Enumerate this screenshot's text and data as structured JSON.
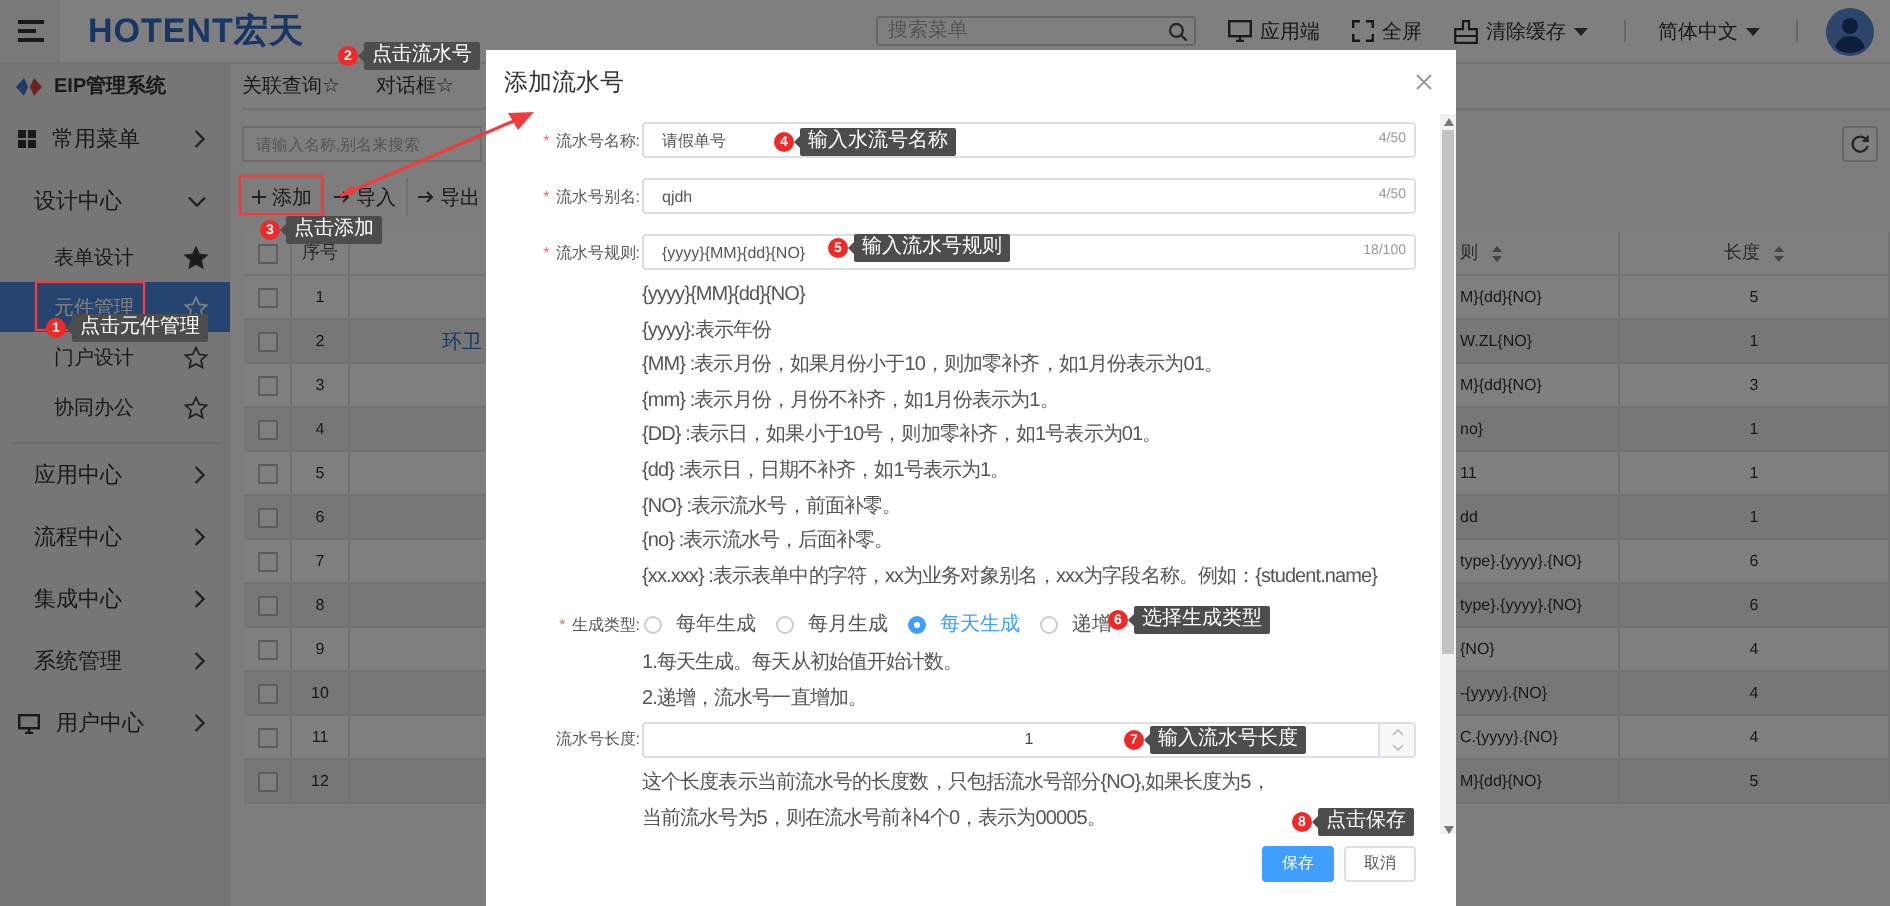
{
  "header": {
    "logo": "HOTENT宏天",
    "search": {
      "placeholder": "搜索菜单"
    },
    "actions": [
      {
        "kind": "app",
        "label": "应用端",
        "dropdown": false
      },
      {
        "kind": "fullscreen",
        "label": "全屏",
        "dropdown": false
      },
      {
        "kind": "cache",
        "label": "清除缓存",
        "dropdown": true
      },
      {
        "kind": "language",
        "label": "简体中文",
        "dropdown": true
      }
    ]
  },
  "sidebar": {
    "title": "EIP管理系统",
    "items": [
      {
        "kind": "grid",
        "label": "常用菜单",
        "expanded": false
      },
      {
        "kind": "plain",
        "label": "设计中心",
        "expanded": true,
        "children": [
          {
            "label": "表单设计",
            "favorite": true,
            "selected": false
          },
          {
            "label": "元件管理",
            "favorite": false,
            "selected": true
          },
          {
            "label": "门户设计",
            "favorite": false,
            "selected": false
          },
          {
            "label": "协同办公",
            "favorite": false,
            "selected": false
          }
        ]
      },
      {
        "kind": "plain",
        "label": "应用中心",
        "expanded": false
      },
      {
        "kind": "plain",
        "label": "流程中心",
        "expanded": false
      },
      {
        "kind": "plain",
        "label": "集成中心",
        "expanded": false
      },
      {
        "kind": "plain",
        "label": "系统管理",
        "expanded": false
      },
      {
        "kind": "monitor",
        "label": "用户中心",
        "expanded": false
      }
    ]
  },
  "tabs": [
    {
      "label": "关联查询☆",
      "selected": false
    },
    {
      "label": "对话框☆",
      "selected": false
    }
  ],
  "search": {
    "placeholder": "请输入名称,别名来搜索"
  },
  "toolbar": [
    {
      "kind": "add",
      "label": "添加"
    },
    {
      "kind": "import",
      "label": "导入"
    },
    {
      "kind": "export",
      "label": "导出"
    }
  ],
  "table": {
    "header_checked": false,
    "columns": [
      {
        "label": "序号",
        "sortable": false
      },
      {
        "label": "则",
        "sortable": true
      },
      {
        "label": "长度",
        "sortable": true
      }
    ],
    "rows": [
      {
        "checked": false,
        "no": "1",
        "rule": "M}{dd}{NO}",
        "length": "5"
      },
      {
        "checked": false,
        "no": "2",
        "name": "环卫",
        "rule": "W.ZL{NO}",
        "length": "1"
      },
      {
        "checked": false,
        "no": "3",
        "rule": "M}{dd}{NO}",
        "length": "3"
      },
      {
        "checked": false,
        "no": "4",
        "rule": "no}",
        "length": "1"
      },
      {
        "checked": false,
        "no": "5",
        "rule": "11",
        "length": "1"
      },
      {
        "checked": false,
        "no": "6",
        "rule": "dd",
        "length": "1"
      },
      {
        "checked": false,
        "no": "7",
        "rule": "type}.{yyyy}.{NO}",
        "length": "6"
      },
      {
        "checked": false,
        "no": "8",
        "rule": "type}.{yyyy}.{NO}",
        "length": "6"
      },
      {
        "checked": false,
        "no": "9",
        "rule": "{NO}",
        "length": "4"
      },
      {
        "checked": false,
        "no": "10",
        "rule": "-{yyyy}.{NO}",
        "length": "4"
      },
      {
        "checked": false,
        "no": "11",
        "rule": "C.{yyyy}.{NO}",
        "length": "4"
      },
      {
        "checked": false,
        "no": "12",
        "rule": "M}{dd}{NO}",
        "length": "5"
      }
    ]
  },
  "dialog": {
    "title": "添加流水号",
    "fields": [
      {
        "label": "流水号名称:",
        "required_mark": "*",
        "value": "请假单号",
        "counter": "4/50"
      },
      {
        "label": "流水号别名:",
        "required_mark": "*",
        "value": "qjdh",
        "counter": "4/50"
      },
      {
        "label": "流水号规则:",
        "required_mark": "*",
        "value": "{yyyy}{MM}{dd}{NO}",
        "counter": "18/100"
      }
    ],
    "rule_help": [
      "{yyyy}{MM}{dd}{NO}",
      "{yyyy}:表示年份",
      "{MM} :表示月份，如果月份小于10，则加零补齐，如1月份表示为01。",
      "{mm} :表示月份，月份不补齐，如1月份表示为1。",
      "{DD} :表示日，如果小于10号，则加零补齐，如1号表示为01。",
      "{dd} :表示日，日期不补齐，如1号表示为1。",
      "{NO} :表示流水号，前面补零。",
      "{no} :表示流水号，后面补零。",
      "{xx.xxx} :表示表单中的字符，xx为业务对象别名，xxx为字段名称。例如：{student.name}"
    ],
    "gen_type": {
      "label": "生成类型:",
      "required_mark": "*",
      "options": [
        {
          "label": "每年生成",
          "selected": false
        },
        {
          "label": "每月生成",
          "selected": false
        },
        {
          "label": "每天生成",
          "selected": true
        },
        {
          "label": "递增",
          "selected": false
        }
      ],
      "help": [
        "1.每天生成。每天从初始值开始计数。",
        "2.递增，流水号一直增加。"
      ]
    },
    "length": {
      "label": "流水号长度:",
      "value": "1",
      "help": "这个长度表示当前流水号的长度数，只包括流水号部分{NO},如果长度为5，当前流水号为5，则在流水号前补4个0，表示为00005。"
    },
    "buttons": [
      {
        "kind": "primary",
        "label": "保存"
      },
      {
        "kind": "default",
        "label": "取消"
      }
    ]
  },
  "annotations": [
    {
      "number": "1",
      "text": "点击元件管理"
    },
    {
      "number": "2",
      "text": "点击流水号"
    },
    {
      "number": "3",
      "text": "点击添加"
    },
    {
      "number": "4",
      "text": "输入水流号名称"
    },
    {
      "number": "5",
      "text": "输入流水号规则"
    },
    {
      "number": "6",
      "text": "选择生成类型"
    },
    {
      "number": "7",
      "text": "输入流水号长度"
    },
    {
      "number": "8",
      "text": "点击保存"
    }
  ]
}
